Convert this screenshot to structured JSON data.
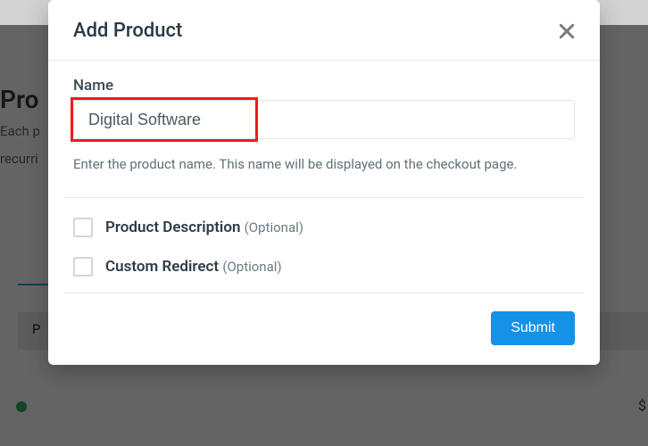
{
  "background": {
    "title_fragment": "Pro",
    "subtitle_line1": "Each p",
    "subtitle_line2": "recurri",
    "row_label": "P",
    "dollar": "$"
  },
  "modal": {
    "title": "Add Product",
    "name_label": "Name",
    "name_value": "Digital Software",
    "help_text": "Enter the product name. This name will be displayed on the checkout page.",
    "option1_label": "Product Description",
    "option1_optional": "(Optional)",
    "option2_label": "Custom Redirect",
    "option2_optional": "(Optional)",
    "submit_label": "Submit"
  }
}
